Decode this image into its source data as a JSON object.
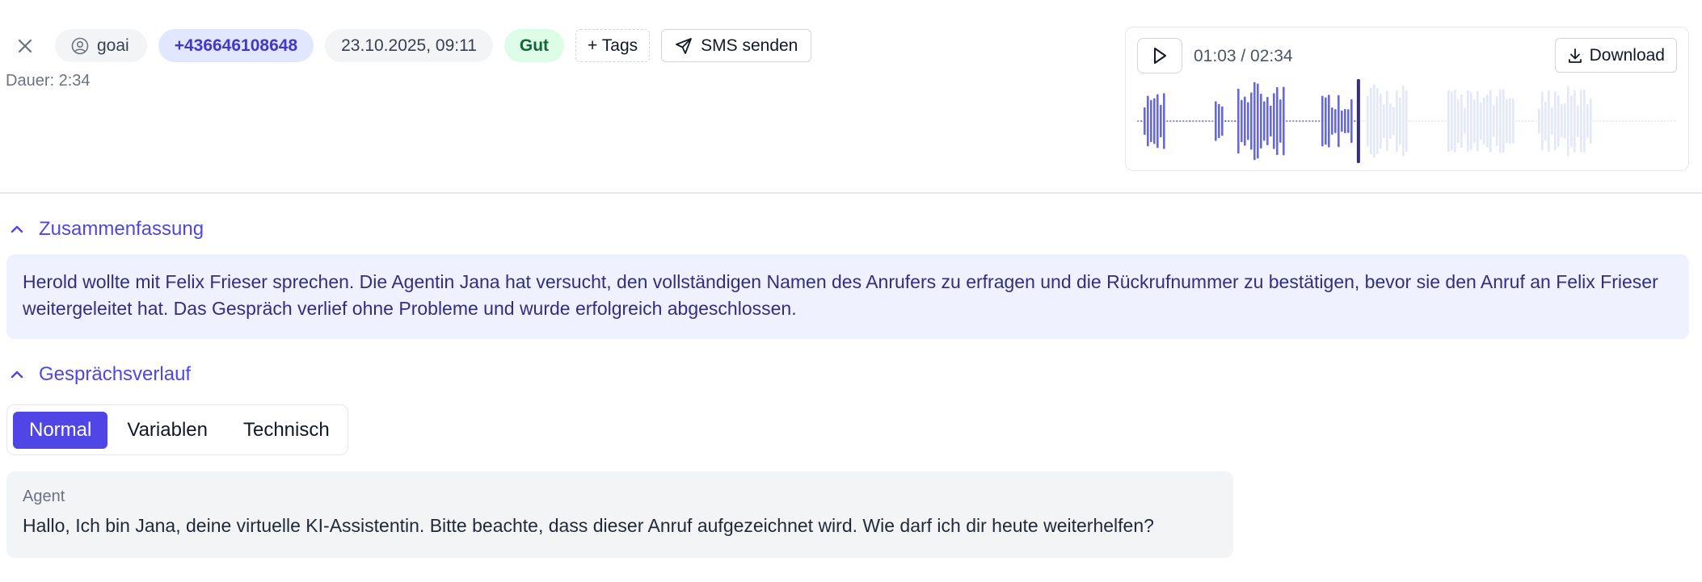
{
  "header": {
    "user": "goai",
    "phone": "+436646108648",
    "datetime": "23.10.2025, 09:11",
    "rating": "Gut",
    "tags_button": "+ Tags",
    "sms_button": "SMS senden",
    "duration": "Dauer: 2:34"
  },
  "player": {
    "time": "01:03 / 02:34",
    "download_label": "Download",
    "progress": 0.41,
    "played_color": "#6366f1",
    "unplayed_color": "#e0e7ff",
    "cursor_color": "#312e81"
  },
  "summary": {
    "title": "Zusammenfassung",
    "text": "Herold wollte mit Felix Frieser sprechen. Die Agentin Jana hat versucht, den vollständigen Namen des Anrufers zu erfragen und die Rückrufnummer zu bestätigen, bevor sie den Anruf an Felix Frieser weitergeleitet hat. Das Gespräch verlief ohne Probleme und wurde erfolgreich abgeschlossen."
  },
  "conversation": {
    "title": "Gesprächsverlauf",
    "tabs": [
      "Normal",
      "Variablen",
      "Technisch"
    ],
    "active_tab": "Normal",
    "messages": [
      {
        "role": "Agent",
        "text": "Hallo, Ich bin Jana, deine virtuelle KI-Assistentin. Bitte beachte, dass dieser Anruf aufgezeichnet wird. Wie darf ich dir heute weiterhelfen?"
      }
    ]
  },
  "colors": {
    "accent": "#4f46e5",
    "summary_bg": "#eef2ff",
    "rating_bg": "#dcfce7"
  }
}
